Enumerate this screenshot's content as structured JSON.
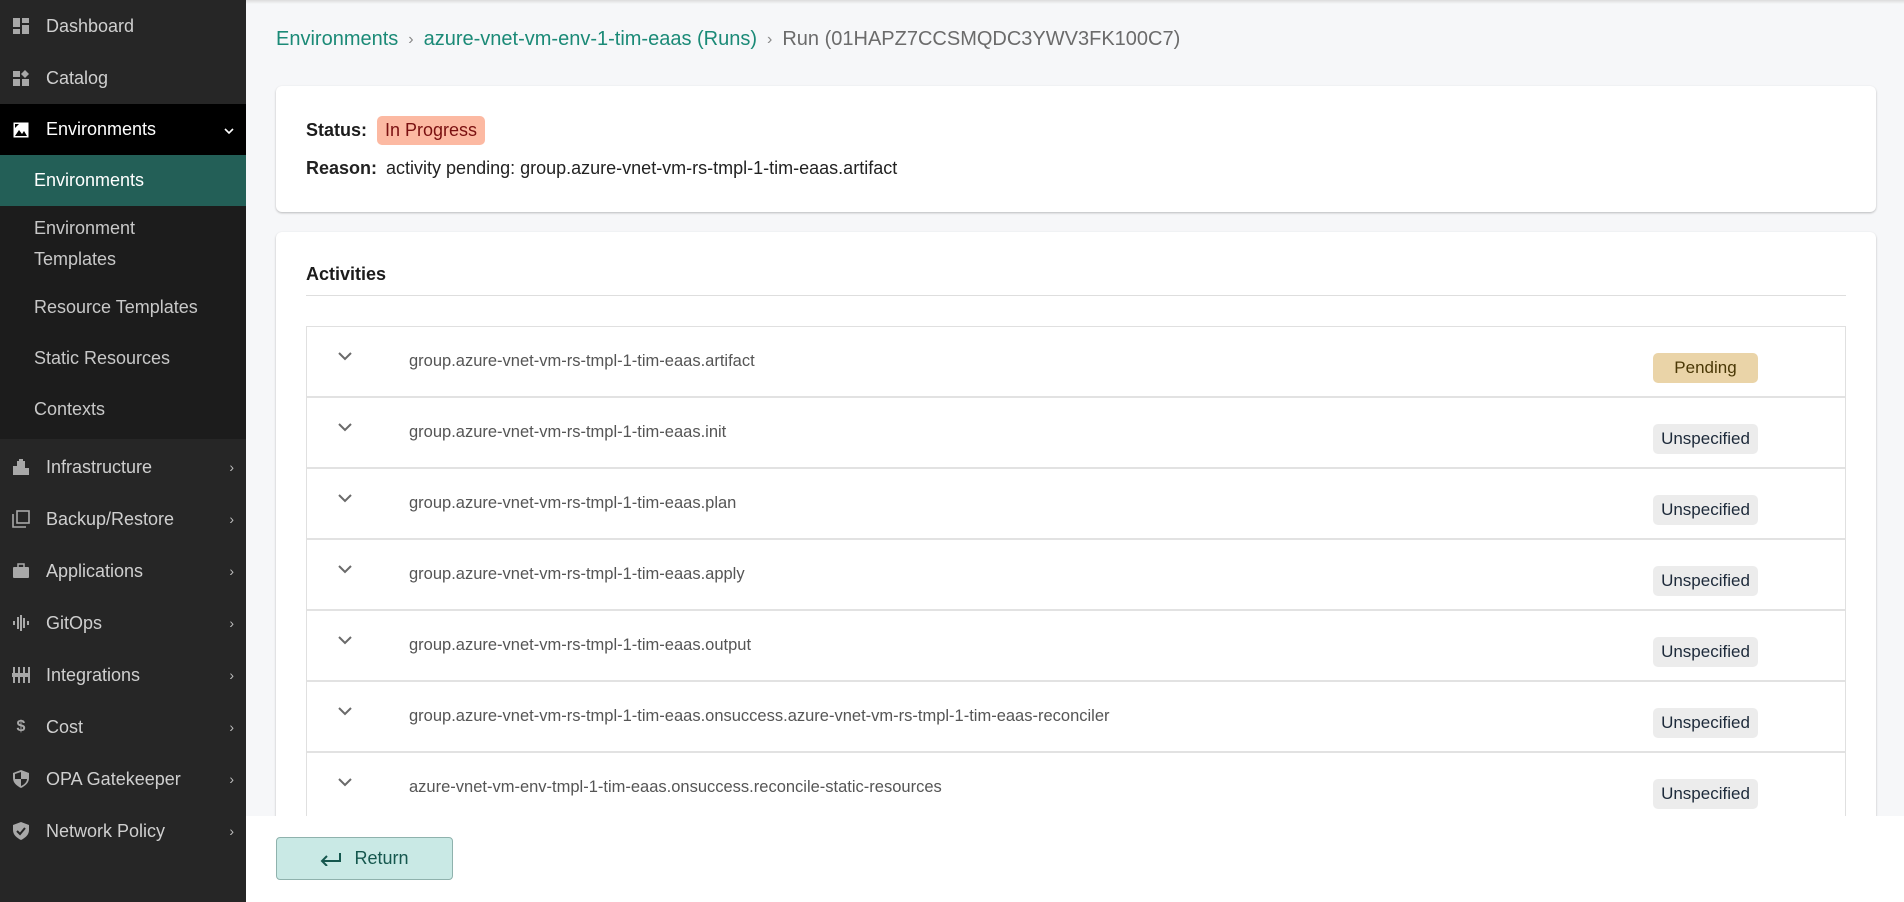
{
  "sidebar": {
    "top_items": [
      {
        "label": "Dashboard",
        "icon": "dashboard-icon"
      },
      {
        "label": "Catalog",
        "icon": "catalog-icon"
      }
    ],
    "active_section": {
      "label": "Environments",
      "icon": "image-icon",
      "expanded": true
    },
    "sub_items": [
      {
        "label": "Environments",
        "active": true
      },
      {
        "label": "Environment Templates",
        "line1": "Environment",
        "line2": "Templates"
      },
      {
        "label": "Resource Templates"
      },
      {
        "label": "Static Resources"
      },
      {
        "label": "Contexts"
      }
    ],
    "lower_items": [
      {
        "label": "Infrastructure",
        "icon": "building-icon"
      },
      {
        "label": "Backup/Restore",
        "icon": "copy-icon"
      },
      {
        "label": "Applications",
        "icon": "briefcase-icon"
      },
      {
        "label": "GitOps",
        "icon": "waveform-icon"
      },
      {
        "label": "Integrations",
        "icon": "sliders-icon"
      },
      {
        "label": "Cost",
        "icon": "dollar-icon"
      },
      {
        "label": "OPA Gatekeeper",
        "icon": "shield-half-icon"
      },
      {
        "label": "Network Policy",
        "icon": "shield-check-icon"
      }
    ]
  },
  "breadcrumb": {
    "items": [
      {
        "label": "Environments",
        "link": true
      },
      {
        "label": "azure-vnet-vm-env-1-tim-eaas (Runs)",
        "link": true
      },
      {
        "label": "Run (01HAPZ7CCSMQDC3YWV3FK100C7)",
        "link": false
      }
    ],
    "separator": "›"
  },
  "status": {
    "label": "Status:",
    "value": "In Progress",
    "reason_label": "Reason:",
    "reason": "activity pending: group.azure-vnet-vm-rs-tmpl-1-tim-eaas.artifact"
  },
  "activities": {
    "title": "Activities",
    "rows": [
      {
        "name": "group.azure-vnet-vm-rs-tmpl-1-tim-eaas.artifact",
        "status": "Pending",
        "kind": "pending"
      },
      {
        "name": "group.azure-vnet-vm-rs-tmpl-1-tim-eaas.init",
        "status": "Unspecified",
        "kind": "unspecified"
      },
      {
        "name": "group.azure-vnet-vm-rs-tmpl-1-tim-eaas.plan",
        "status": "Unspecified",
        "kind": "unspecified"
      },
      {
        "name": "group.azure-vnet-vm-rs-tmpl-1-tim-eaas.apply",
        "status": "Unspecified",
        "kind": "unspecified"
      },
      {
        "name": "group.azure-vnet-vm-rs-tmpl-1-tim-eaas.output",
        "status": "Unspecified",
        "kind": "unspecified"
      },
      {
        "name": "group.azure-vnet-vm-rs-tmpl-1-tim-eaas.onsuccess.azure-vnet-vm-rs-tmpl-1-tim-eaas-reconciler",
        "status": "Unspecified",
        "kind": "unspecified"
      },
      {
        "name": "azure-vnet-vm-env-tmpl-1-tim-eaas.onsuccess.reconcile-static-resources",
        "status": "Unspecified",
        "kind": "unspecified"
      }
    ]
  },
  "footer": {
    "return_label": "Return",
    "return_icon": "return-arrow-icon"
  },
  "colors": {
    "accent": "#1b8a77",
    "active_nav_bg": "#235f57",
    "in_progress_bg": "#fcb9a2",
    "pending_bg": "#ead4a8",
    "unspecified_bg": "#ececec",
    "return_bg": "#c9e9e5"
  }
}
